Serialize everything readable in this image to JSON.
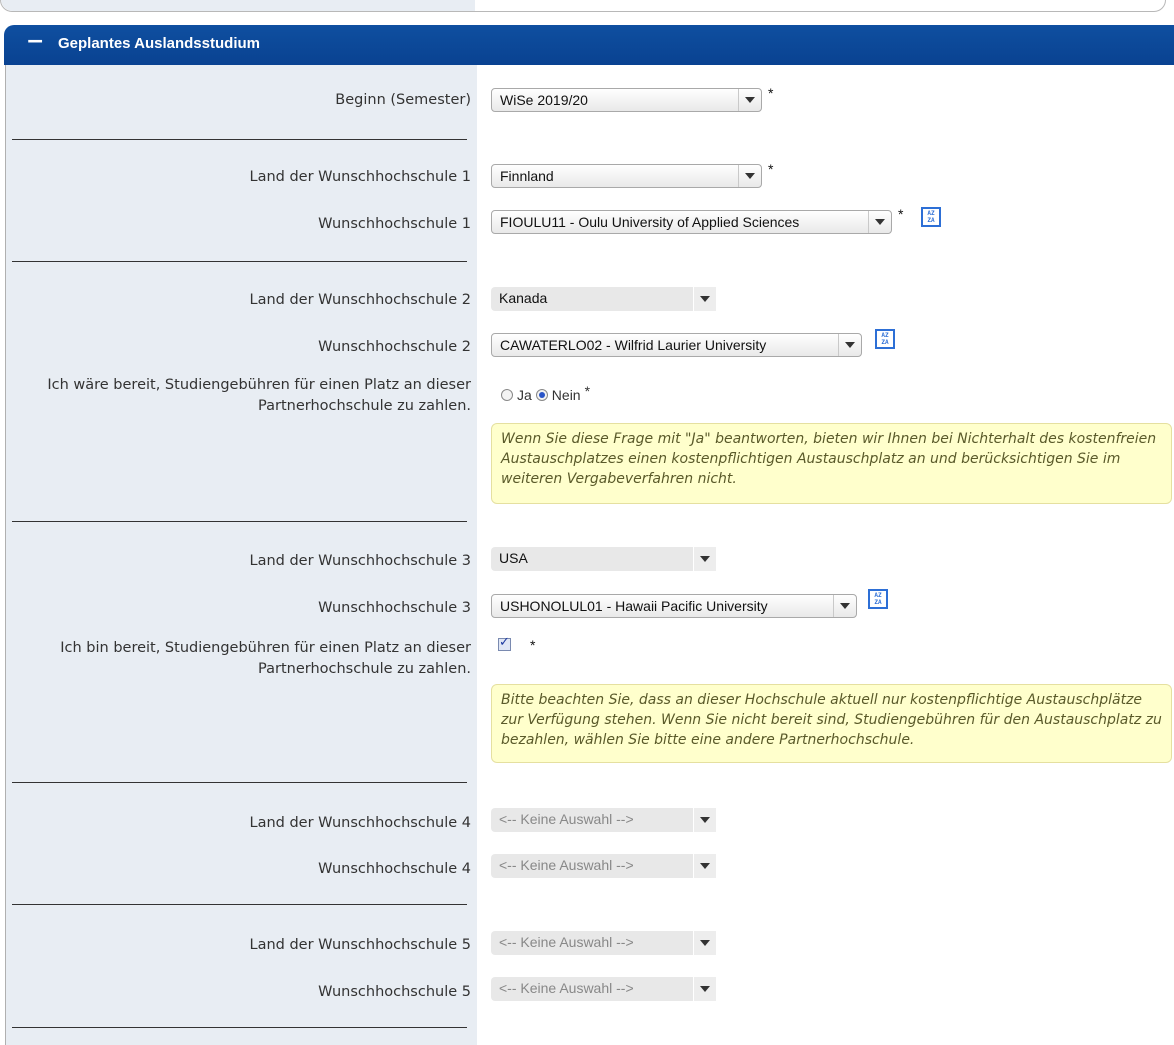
{
  "panel": {
    "toggle": "−",
    "title": "Geplantes Auslandsstudium"
  },
  "semester": {
    "label": "Beginn (Semester)",
    "value": "WiSe 2019/20"
  },
  "choice1": {
    "country_label": "Land der Wunschhochschule 1",
    "country_value": "Finnland",
    "school_label": "Wunschhochschule 1",
    "school_value": "FIOULU11 - Oulu University of Applied Sciences"
  },
  "choice2": {
    "country_label": "Land der Wunschhochschule 2",
    "country_value": "Kanada",
    "school_label": "Wunschhochschule 2",
    "school_value": "CAWATERLO02 - Wilfrid Laurier University",
    "fee_label": "Ich wäre bereit, Studiengebühren für einen Platz an dieser Partnerhochschule zu zahlen.",
    "yes_label": "Ja",
    "no_label": "Nein",
    "selected": "Nein",
    "note": "Wenn Sie diese Frage mit \"Ja\" beantworten, bieten wir Ihnen bei Nichterhalt des kostenfreien Austauschplatzes einen kostenpflichtigen Austauschplatz an und berücksichtigen Sie im weiteren Vergabeverfahren nicht."
  },
  "choice3": {
    "country_label": "Land der Wunschhochschule 3",
    "country_value": "USA",
    "school_label": "Wunschhochschule 3",
    "school_value": "USHONOLUL01 - Hawaii Pacific University",
    "fee_label": "Ich bin bereit, Studiengebühren für einen Platz an dieser Partnerhochschule zu zahlen.",
    "checked": true,
    "note": "Bitte beachten Sie, dass an dieser Hochschule aktuell nur kostenpflichtige Austauschplätze zur Verfügung stehen. Wenn Sie nicht bereit sind, Studiengebühren für den Austauschplatz zu bezahlen, wählen Sie bitte eine andere Partnerhochschule."
  },
  "choice4": {
    "country_label": "Land der Wunschhochschule 4",
    "country_value": "<-- Keine Auswahl -->",
    "school_label": "Wunschhochschule 4",
    "school_value": "<-- Keine Auswahl -->"
  },
  "choice5": {
    "country_label": "Land der Wunschhochschule 5",
    "country_value": "<-- Keine Auswahl -->",
    "school_label": "Wunschhochschule 5",
    "school_value": "<-- Keine Auswahl -->"
  },
  "required_marker": "*",
  "icons": {
    "lookup": "az-lookup-icon",
    "collapse": "minus-icon"
  },
  "colors": {
    "header": "#094291",
    "label_bg": "#e8edf3",
    "note_bg": "#ffffcc"
  }
}
